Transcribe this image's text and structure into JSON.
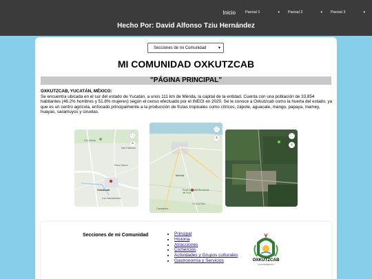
{
  "nav": {
    "home": "Inicio",
    "menus": [
      {
        "label": "Parcial 1"
      },
      {
        "label": "Parcial 2"
      },
      {
        "label": "Parcial 3"
      }
    ]
  },
  "author": "Hecho Por: David Alfonso Tziu Hernández",
  "sections_select": {
    "value": "Secciones de mi Comunidad"
  },
  "title": "MI COMUNIDAD OXKUTZCAB",
  "subtitle": "\"PÁGINA PRINCIPAL\"",
  "intro": {
    "heading": "OXKUTZCAB, YUCATÁN, MÉXICO:",
    "text": "Se encuentra ubicada en el sur del estado de Yucatán, a unos 111 km de Mérida, la capital de la entidad. Cuenta con una población de 33,854 habitantes (48.2% hombres y 51.8% mujeres) según el censo efectuado por el INEGI en 2020. Se le conoce a Oxkutzcab como la huerta del estado, ya que es un centro agrícola, enfocado principalmente a la producción de frutas tropicales como cítricos, zapote, aguacate, mango, papaya, mamey, huayas, saramuyos y ciruelas."
  },
  "maps": {
    "map1": {
      "labels": [
        "San Fidencio",
        "Pozo Nuevo",
        "Oxkutzcab",
        "Los Yaxcabantes",
        "Lico Mona"
      ]
    },
    "map2": {
      "labels": [
        "Mérida",
        "Reserva Estatal Biocultural del Puuc",
        "YUCATÁN",
        "Campeche"
      ]
    },
    "map3": {
      "labels": []
    }
  },
  "footer": {
    "title": "Secciones de mi Comunidad",
    "links": [
      "Principal",
      "Historia",
      "Atracciones",
      "Comercios",
      "Actividades y Grupos culturales",
      "Gastronomía y Servicios"
    ],
    "logo_text": "OXKUTZCAB",
    "logo_sub": "AYUNTAMIENTO"
  },
  "colors": {
    "background": "#87ceeb",
    "topbar": "#3b3b3b",
    "heading_band": "#c8c8c8",
    "link": "#1a0dab"
  }
}
